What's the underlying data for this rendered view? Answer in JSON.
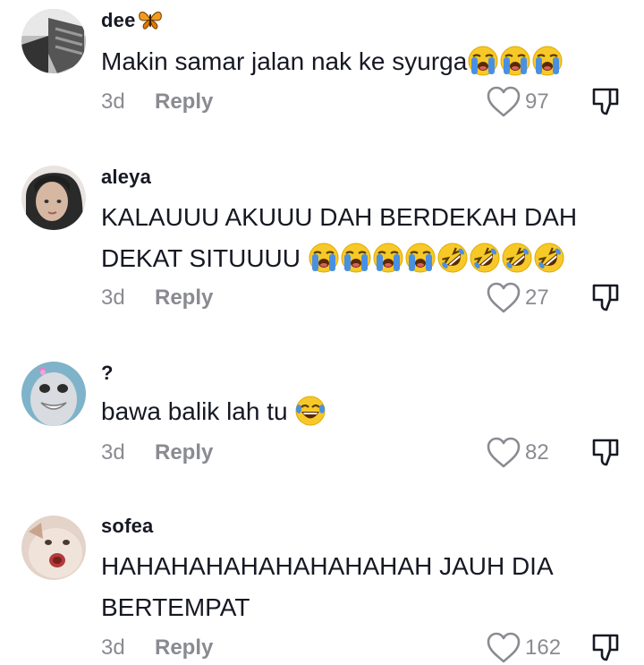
{
  "comments": [
    {
      "username": "dee",
      "text": "Makin samar jalan nak ke syurga",
      "time": "3d",
      "reply_label": "Reply",
      "likes": "97",
      "emojis": [
        "loudly-crying-face",
        "loudly-crying-face",
        "loudly-crying-face"
      ]
    },
    {
      "username": "aleya",
      "text_line1": "KALAUUU AKUUU DAH BERDEKAH DAH",
      "text_line2": "DEKAT SITUUUU",
      "time": "3d",
      "reply_label": "Reply",
      "likes": "27",
      "emojis": [
        "loudly-crying-face",
        "loudly-crying-face",
        "loudly-crying-face",
        "loudly-crying-face",
        "rolling-on-floor-laughing",
        "rolling-on-floor-laughing",
        "rolling-on-floor-laughing",
        "rolling-on-floor-laughing"
      ]
    },
    {
      "username": "?",
      "text": "bawa balik lah tu",
      "time": "3d",
      "reply_label": "Reply",
      "likes": "82",
      "emojis": [
        "face-with-tears-of-joy"
      ]
    },
    {
      "username": "sofea",
      "text_line1": "HAHAHAHAHAHAHAHAHAH JAUH DIA",
      "text_line2": "BERTEMPAT",
      "time": "3d",
      "reply_label": "Reply",
      "likes": "162"
    }
  ],
  "icons": {
    "like": "heart-outline-icon",
    "dislike": "thumbs-down-outline-icon",
    "badge": "butterfly-icon"
  },
  "colors": {
    "text": "#161823",
    "meta": "#8a8b91",
    "emoji_yellow": "#f7c928",
    "tear_blue": "#4a90e2"
  }
}
